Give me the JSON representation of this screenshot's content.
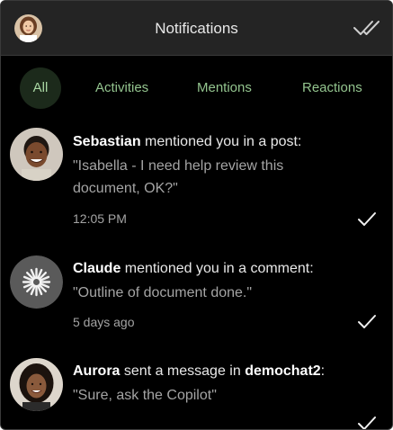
{
  "header": {
    "title": "Notifications",
    "avatar_icon": "user-avatar",
    "mark_all_icon": "double-check-icon"
  },
  "tabs": [
    {
      "label": "All",
      "active": true
    },
    {
      "label": "Activities",
      "active": false
    },
    {
      "label": "Mentions",
      "active": false
    },
    {
      "label": "Reactions",
      "active": false
    }
  ],
  "notifications": [
    {
      "sender": "Sebastian",
      "action": " mentioned you in a post:",
      "message": "\"Isabella - I need help review this document, OK?\"",
      "time": "12:05 PM",
      "avatar_icon": "person-avatar"
    },
    {
      "sender": "Claude",
      "action": " mentioned you in a comment:",
      "message": "\"Outline of document done.\"",
      "time": "5 days ago",
      "avatar_icon": "starburst-avatar"
    },
    {
      "sender": "Aurora",
      "action": " sent a message in ",
      "channel": "demochat2",
      "channel_suffix": ":",
      "message": "\"Sure, ask the Copilot\"",
      "time": "",
      "avatar_icon": "person-avatar"
    }
  ],
  "colors": {
    "background": "#000000",
    "header_bg": "#242424",
    "tab_text": "#93c48e",
    "tab_active_bg": "#1c2a1b",
    "secondary_text": "#a4a4a4"
  }
}
